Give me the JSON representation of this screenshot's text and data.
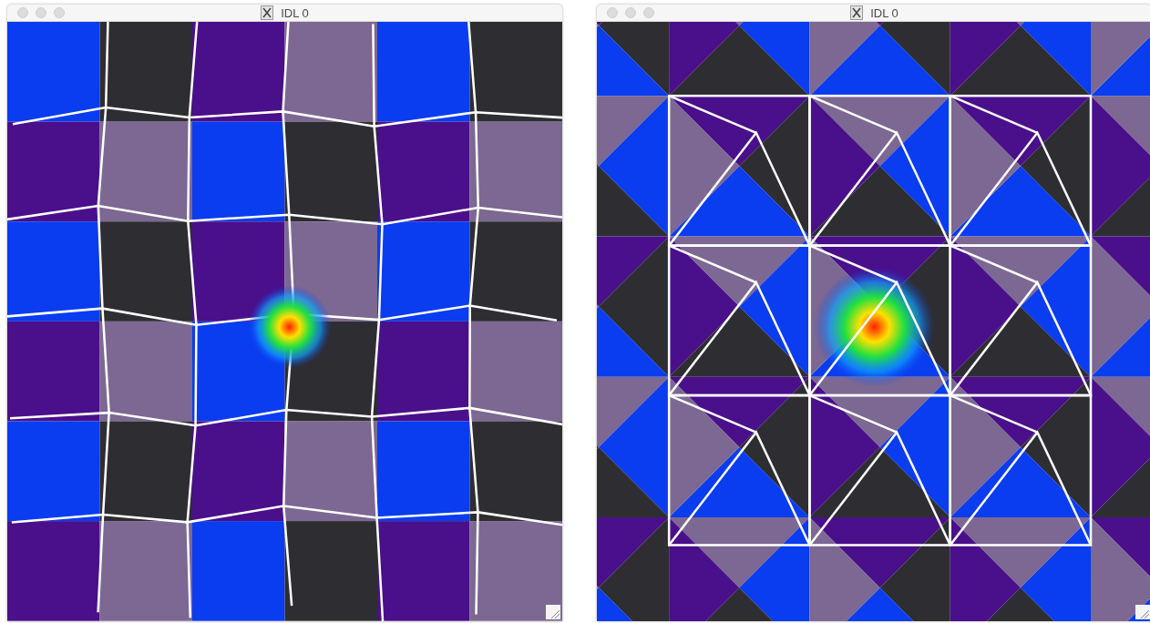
{
  "windows": [
    {
      "title": "IDL 0",
      "kind": "warped-grid"
    },
    {
      "title": "IDL 0",
      "kind": "triangle-grid"
    }
  ]
}
